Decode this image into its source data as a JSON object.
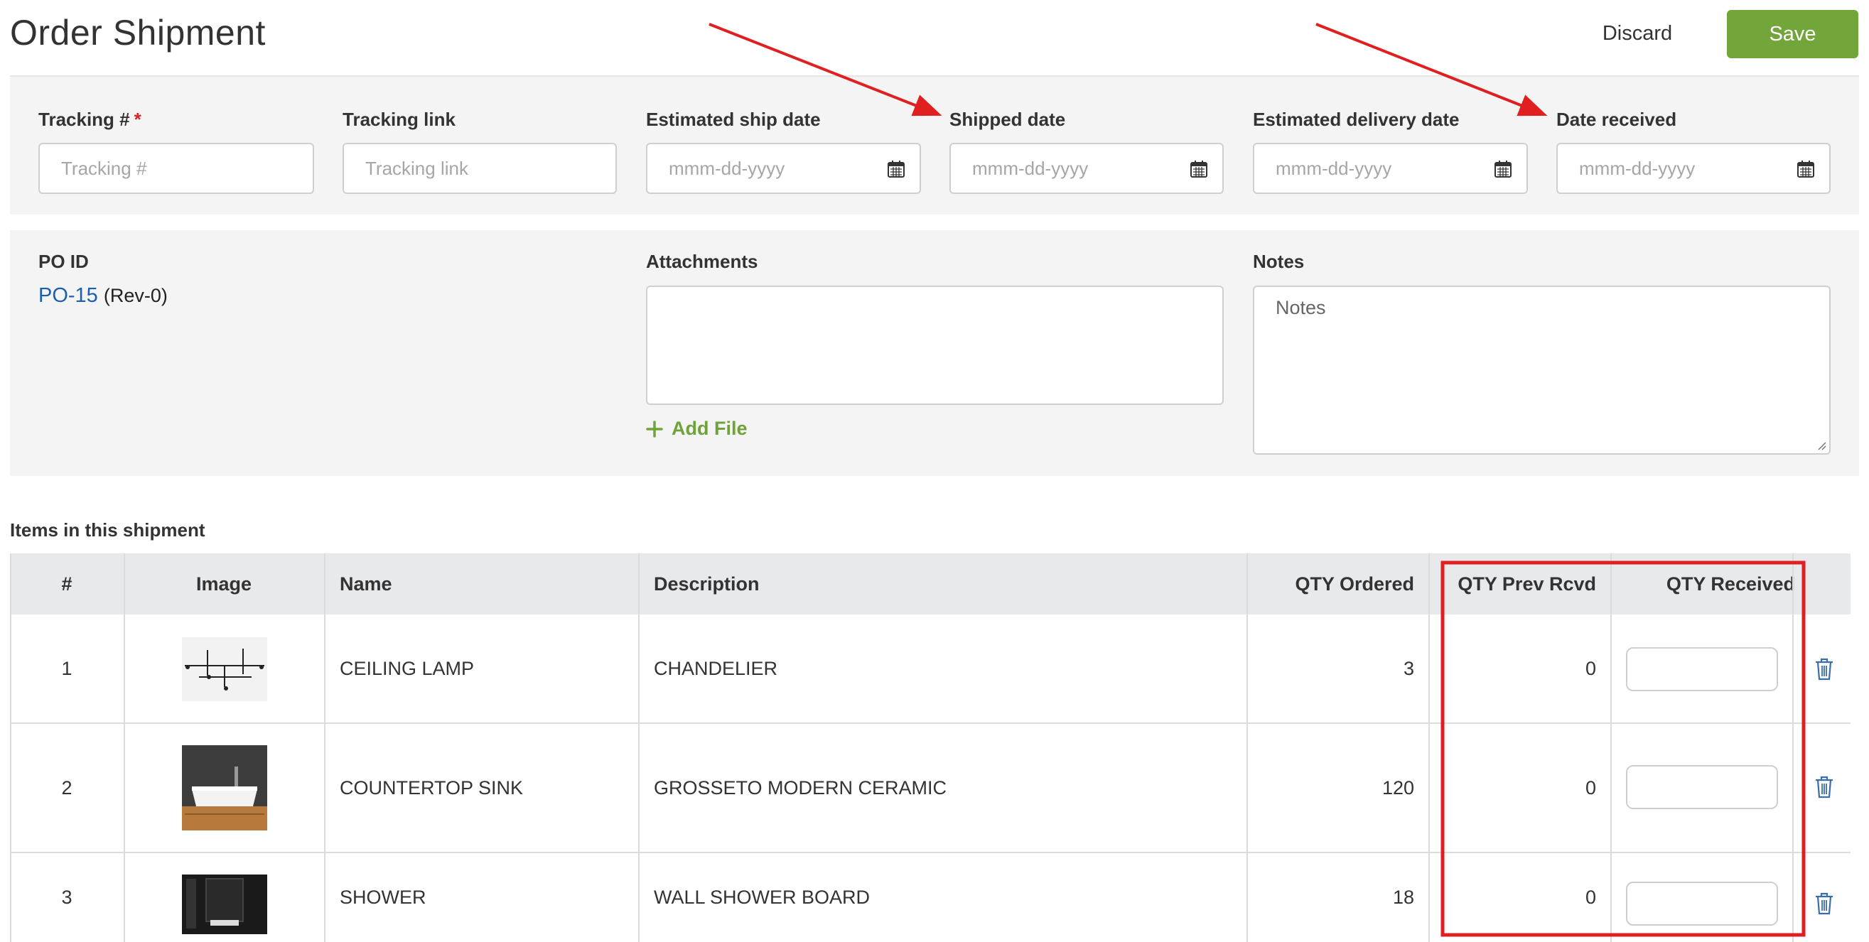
{
  "header": {
    "title": "Order Shipment",
    "discard_label": "Discard",
    "save_label": "Save"
  },
  "tracking": {
    "fields": [
      {
        "label": "Tracking #",
        "required": true,
        "placeholder": "Tracking #"
      },
      {
        "label": "Tracking link",
        "placeholder": "Tracking link"
      },
      {
        "label": "Estimated ship date",
        "placeholder": "mmm-dd-yyyy"
      },
      {
        "label": "Shipped date",
        "placeholder": "mmm-dd-yyyy"
      },
      {
        "label": "Estimated delivery date",
        "placeholder": "mmm-dd-yyyy"
      },
      {
        "label": "Date received",
        "placeholder": "mmm-dd-yyyy"
      }
    ],
    "required_mark": "*"
  },
  "details": {
    "po_label": "PO ID",
    "po_id": "PO-15",
    "po_rev": "(Rev-0)",
    "attachments_label": "Attachments",
    "add_file_label": "Add File",
    "notes_label": "Notes",
    "notes_placeholder": "Notes"
  },
  "items": {
    "section_label": "Items in this shipment",
    "columns": [
      "#",
      "Image",
      "Name",
      "Description",
      "QTY Ordered",
      "QTY Prev Rcvd",
      "QTY Received"
    ],
    "rows": [
      {
        "num": "1",
        "name": "CEILING LAMP",
        "description": "CHANDELIER",
        "qty_ordered": "3",
        "qty_prev": "0",
        "qty_received": ""
      },
      {
        "num": "2",
        "name": "COUNTERTOP SINK",
        "description": "GROSSETO MODERN CERAMIC",
        "qty_ordered": "120",
        "qty_prev": "0",
        "qty_received": ""
      },
      {
        "num": "3",
        "name": "SHOWER",
        "description": "WALL SHOWER BOARD",
        "qty_ordered": "18",
        "qty_prev": "0",
        "qty_received": ""
      }
    ]
  },
  "colors": {
    "accent_green": "#72a53a",
    "link_blue": "#1b5fb0",
    "annotation_red": "#e02020"
  }
}
